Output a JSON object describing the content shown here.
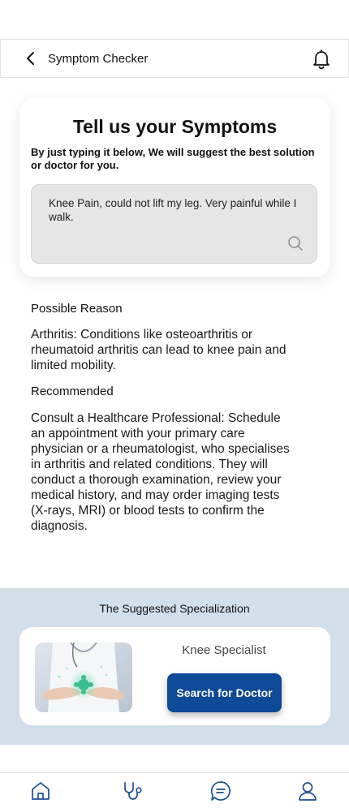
{
  "header": {
    "title": "Symptom Checker",
    "back_icon": "chevron-left-icon",
    "notification_icon": "bell-icon"
  },
  "symptom_card": {
    "title": "Tell us your Symptoms",
    "subtitle": "By just typing it below, We will suggest the best solution or doctor for you.",
    "input_value": "Knee Pain, could not lift my leg. Very painful while I walk.",
    "search_icon": "search-icon"
  },
  "possible_reason": {
    "heading": "Possible Reason",
    "text": "Arthritis: Conditions like osteoarthritis or rheumatoid arthritis can lead to knee pain and limited mobility."
  },
  "recommended": {
    "heading": "Recommended",
    "text": "Consult a Healthcare Professional: Schedule an appointment with your primary care physician or a rheumatologist, who specialises in arthritis and related conditions. They will conduct a thorough examination, review your medical history, and may order imaging tests (X-rays, MRI) or blood tests to confirm the diagnosis."
  },
  "specialization": {
    "title": "The Suggested Specialization",
    "name": "Knee Specialist",
    "button_label": "Search for Doctor"
  },
  "bottom_nav": {
    "items": [
      "home-icon",
      "stethoscope-icon",
      "chat-icon",
      "profile-icon"
    ]
  },
  "colors": {
    "primary": "#0f4a96",
    "section_bg": "#d3deeb",
    "input_bg": "#e6e6e6",
    "nav_icon": "#1a4f93"
  }
}
